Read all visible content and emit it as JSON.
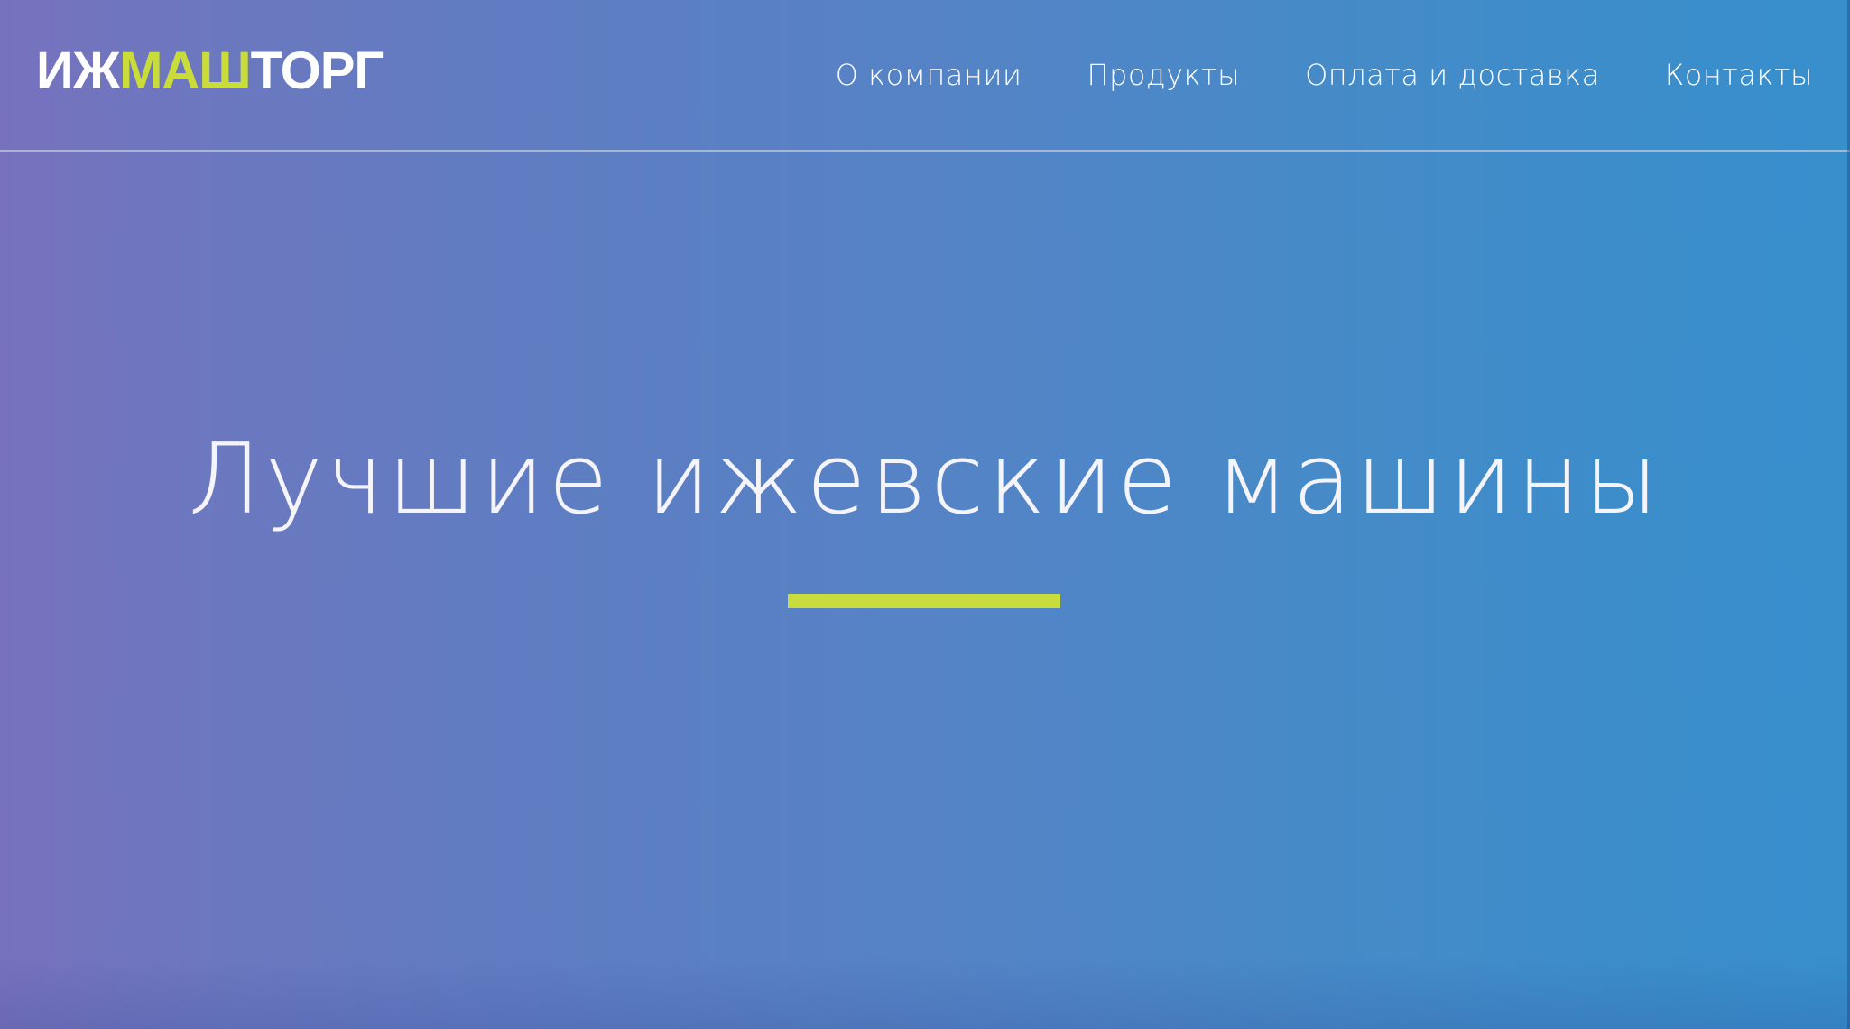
{
  "header": {
    "logo": {
      "part1": "ИЖ",
      "part2": "МАШ",
      "part3": "ТОРГ"
    },
    "nav": [
      {
        "label": "О компании"
      },
      {
        "label": "Продукты"
      },
      {
        "label": "Оплата и доставка"
      },
      {
        "label": "Контакты"
      }
    ]
  },
  "hero": {
    "title": "Лучшие ижевские машины"
  },
  "colors": {
    "accent": "#c8dc3b",
    "gradient_start": "#7771bd",
    "gradient_end": "#378fcc",
    "text": "#ffffff"
  }
}
